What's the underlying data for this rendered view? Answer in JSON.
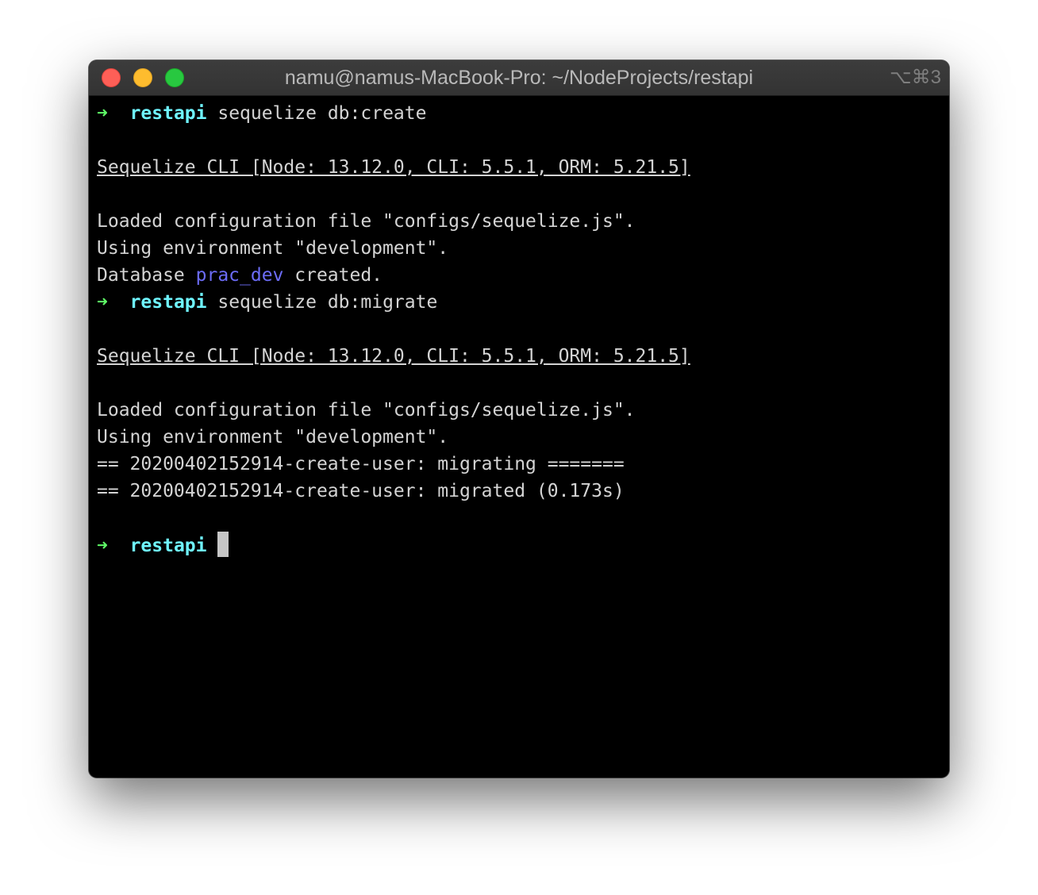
{
  "window": {
    "title": "namu@namus-MacBook-Pro: ~/NodeProjects/restapi",
    "shortcut": "⌥⌘3"
  },
  "colors": {
    "prompt_arrow": "#5ff967",
    "prompt_dir": "#6ff5ff",
    "db_name": "#6c6cf6",
    "text": "#d4d4d4",
    "background": "#000000"
  },
  "terminal": {
    "prompt_arrow": "➜",
    "prompt_dir": "restapi",
    "cmd1": "sequelize db:create",
    "banner1": "Sequelize CLI [Node: 13.12.0, CLI: 5.5.1, ORM: 5.21.5]",
    "loaded1": "Loaded configuration file \"configs/sequelize.js\".",
    "env1": "Using environment \"development\".",
    "db_prefix": "Database ",
    "db_name": "prac_dev",
    "db_suffix": " created.",
    "cmd2": "sequelize db:migrate",
    "banner2": "Sequelize CLI [Node: 13.12.0, CLI: 5.5.1, ORM: 5.21.5]",
    "loaded2": "Loaded configuration file \"configs/sequelize.js\".",
    "env2": "Using environment \"development\".",
    "migrating": "== 20200402152914-create-user: migrating =======",
    "migrated": "== 20200402152914-create-user: migrated (0.173s)"
  }
}
